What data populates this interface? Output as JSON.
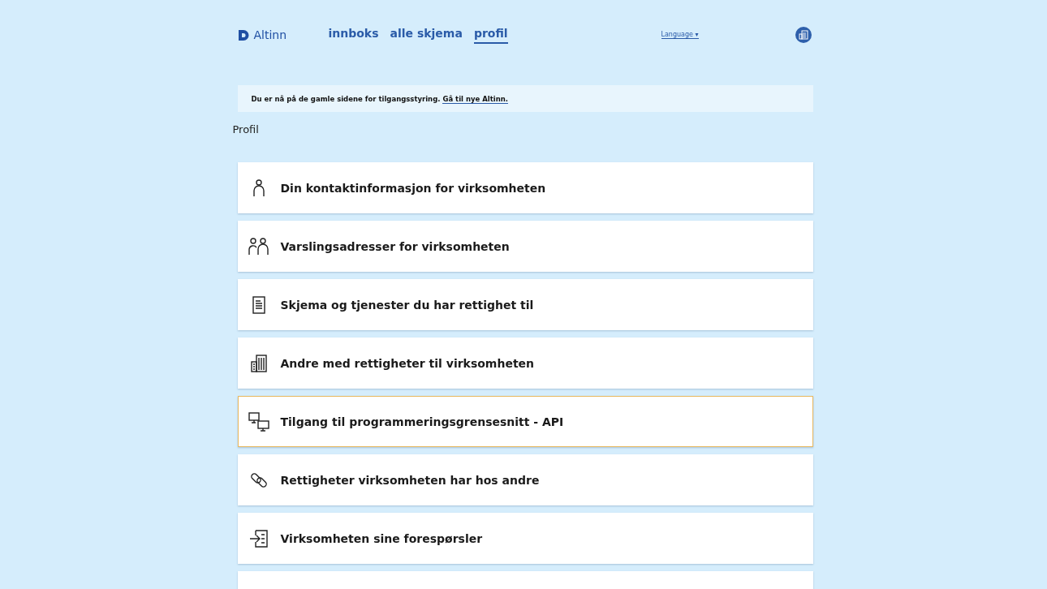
{
  "header": {
    "logo": "Altinn",
    "nav": [
      {
        "label": "innboks",
        "selected": false
      },
      {
        "label": "alle skjema",
        "selected": false
      },
      {
        "label": "profil",
        "selected": true
      }
    ],
    "language": "Language ▾"
  },
  "notice": {
    "text": "Du er nå på de gamle sidene for tilgangsstyring.",
    "link": "Gå til nye Altinn."
  },
  "heading": "Profil",
  "items": [
    {
      "kind": "person",
      "label": "Din kontaktinformasjon for virksomheten",
      "highlighted": false
    },
    {
      "kind": "people",
      "label": "Varslingsadresser for virksomheten",
      "highlighted": false
    },
    {
      "kind": "document",
      "label": "Skjema og tjenester du har rettighet til",
      "highlighted": false
    },
    {
      "kind": "building",
      "label": "Andre med rettigheter til virksomheten",
      "highlighted": false
    },
    {
      "kind": "monitors",
      "label": "Tilgang til programmeringsgrensesnitt - API",
      "highlighted": true
    },
    {
      "kind": "link",
      "label": "Rettigheter virksomheten har hos andre",
      "highlighted": false
    },
    {
      "kind": "inbox",
      "label": "Virksomheten sine forespørsler",
      "highlighted": false
    },
    {
      "kind": "partial",
      "highlighted": false
    }
  ]
}
